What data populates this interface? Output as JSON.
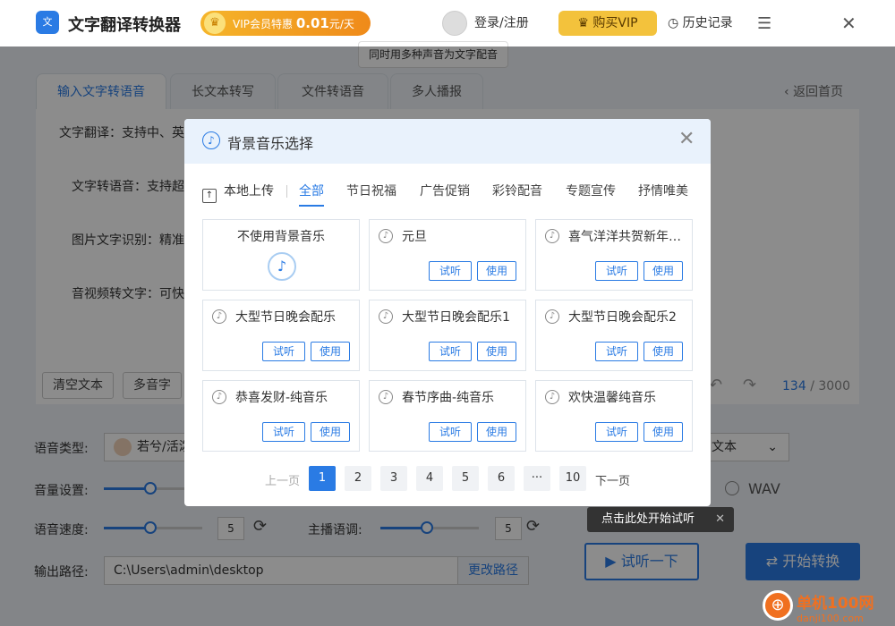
{
  "app": {
    "icon_text": "文",
    "title": "文字翻译转换器",
    "vip_promo_prefix": "VIP会员特惠",
    "vip_promo_price": "0.01",
    "vip_promo_suffix": "元/天",
    "login": "登录/注册",
    "buy_vip": "购买VIP",
    "history": "历史记录",
    "tooltip": "同时用多种声音为文字配音"
  },
  "tabs": [
    "输入文字转语音",
    "长文本转写",
    "文件转语音",
    "多人播报"
  ],
  "back_home": "返回首页",
  "features": [
    "文字翻译：支持中、英",
    "文字转语音：支持超",
    "图片文字识别：精准",
    "音视频转文字：可快"
  ],
  "editor_buttons": {
    "clear": "清空文本",
    "polyphone": "多音字"
  },
  "counter": {
    "current": "134",
    "separator": "/",
    "max": "3000"
  },
  "settings": {
    "voice_type_label": "语音类型:",
    "voice_name": "若兮/活泼",
    "volume_label": "音量设置:",
    "speed_label": "语音速度:",
    "speed_value": "5",
    "pitch_label": "主播语调:",
    "pitch_value": "5",
    "format_value": "文本",
    "wav_label": "WAV",
    "output_label": "输出路径:",
    "output_path": "C:\\Users\\admin\\desktop",
    "change_path": "更改路径"
  },
  "actions": {
    "hint": "点击此处开始试听",
    "try": "试听一下",
    "start": "开始转换"
  },
  "watermark": {
    "name": "单机100网",
    "url": "danji100.com"
  },
  "modal": {
    "title": "背景音乐选择",
    "upload": "本地上传",
    "tabs": [
      "全部",
      "节日祝福",
      "广告促销",
      "彩铃配音",
      "专题宣传",
      "抒情唯美"
    ],
    "no_music": "不使用背景音乐",
    "try_label": "试听",
    "use_label": "使用",
    "items": [
      "元旦",
      "喜气洋洋共贺新年…",
      "大型节日晚会配乐",
      "大型节日晚会配乐1",
      "大型节日晚会配乐2",
      "恭喜发财-纯音乐",
      "春节序曲-纯音乐",
      "欢快温馨纯音乐"
    ],
    "pagination": {
      "prev": "上一页",
      "pages": [
        "1",
        "2",
        "3",
        "4",
        "5",
        "6",
        "···",
        "10"
      ],
      "next": "下一页",
      "current": "1"
    }
  },
  "colors": {
    "accent": "#2a7be4",
    "vip": "#f3c23c"
  }
}
